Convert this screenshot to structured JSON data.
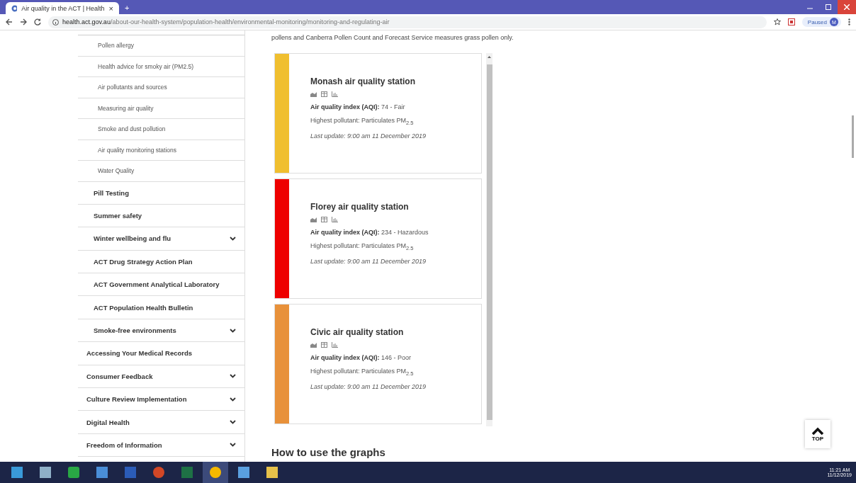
{
  "browser": {
    "tab_title": "Air quality in the ACT | Health",
    "tab_close": "×",
    "new_tab": "+",
    "url_host": "health.act.gov.au",
    "url_path": "/about-our-health-system/population-health/environmental-monitoring/monitoring-and-regulating-air",
    "profile_status": "Paused",
    "profile_initial": "M"
  },
  "sidebar": {
    "items": [
      {
        "children": [
          {
            "children": [
              {
                "label": "Pollen allergy"
              },
              {
                "label": "Health advice for smoky air (PM2.5)"
              },
              {
                "label": "Air pollutants and sources"
              },
              {
                "label": "Measuring air quality"
              },
              {
                "label": "Smoke and dust pollution"
              },
              {
                "label": "Air quality monitoring stations"
              },
              {
                "label": "Water Quality"
              }
            ]
          },
          {
            "label": "Pill Testing",
            "expandable": false
          },
          {
            "label": "Summer safety",
            "expandable": false
          },
          {
            "label": "Winter wellbeing and flu",
            "expandable": true
          },
          {
            "label": "ACT Drug Strategy Action Plan",
            "expandable": false
          },
          {
            "label": "ACT Government Analytical Laboratory",
            "expandable": false
          },
          {
            "label": "ACT Population Health Bulletin",
            "expandable": false
          },
          {
            "label": "Smoke-free environments",
            "expandable": true
          }
        ]
      },
      {
        "label": "Accessing Your Medical Records",
        "expandable": false
      },
      {
        "label": "Consumer Feedback",
        "expandable": true
      },
      {
        "label": "Culture Review Implementation",
        "expandable": true
      },
      {
        "label": "Digital Health",
        "expandable": true
      },
      {
        "label": "Freedom of Information",
        "expandable": true
      }
    ]
  },
  "main": {
    "intro": "pollens and Canberra Pollen Count and Forecast Service measures grass pollen only.",
    "stations": [
      {
        "title": "Monash air quality station",
        "aqi_label": "Air quality index (AQI):",
        "aqi_value": "74 - Fair",
        "pollutant": "Highest pollutant: Particulates PM$_{2.5}$",
        "updated": "Last update: 9:00 am 11 December 2019",
        "color": "#f0bf2f"
      },
      {
        "title": "Florey air quality station",
        "aqi_label": "Air quality index (AQI):",
        "aqi_value": "234 - Hazardous",
        "pollutant": "Highest pollutant: Particulates PM$_{2.5}$",
        "updated": "Last update: 9:00 am 11 December 2019",
        "color": "#ee0000"
      },
      {
        "title": "Civic air quality station",
        "aqi_label": "Air quality index (AQI):",
        "aqi_value": "146 - Poor",
        "pollutant": "Highest pollutant: Particulates PM$_{2.5}$",
        "updated": "Last update: 9:00 am 11 December 2019",
        "color": "#e8913a"
      }
    ],
    "heading": "How to use the graphs",
    "top_button": "TOP"
  },
  "taskbar": {
    "time": "11:21 AM",
    "date": "11/12/2019"
  }
}
